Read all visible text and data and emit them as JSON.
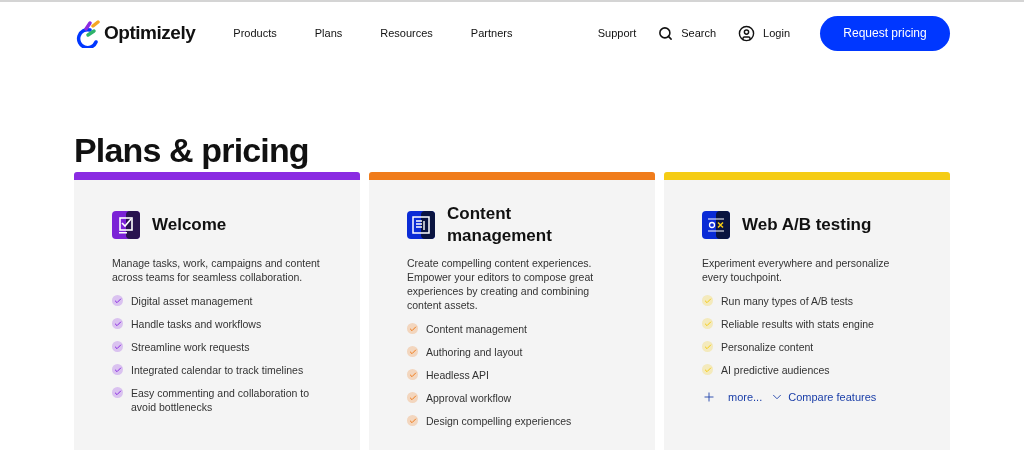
{
  "brand": {
    "name": "Optimizely"
  },
  "nav": [
    "Products",
    "Plans",
    "Resources",
    "Partners"
  ],
  "utility": [
    {
      "kind": "text",
      "label": "Support"
    },
    {
      "kind": "search",
      "label": "Search"
    },
    {
      "kind": "user",
      "label": "Login"
    }
  ],
  "cta": "Request pricing",
  "title": "Plans & pricing",
  "plans": [
    {
      "name": "Welcome",
      "kind": "board",
      "color": "#8a2be2",
      "description": "Manage tasks, work, campaigns and content across teams for seamless collaboration.",
      "features": [
        "Digital asset management",
        "Handle tasks and workflows",
        "Streamline work requests",
        "Integrated calendar to track timelines",
        "Easy commenting and collaboration to avoid bottlenecks"
      ]
    },
    {
      "name": "Content management",
      "kind": "document",
      "color": "#f07c1b",
      "description": "Create compelling content experiences. Empower your editors to compose great experiences by creating and combining content assets.",
      "features": [
        "Content management",
        "Authoring and layout",
        "Headless API",
        "Approval workflow",
        "Design compelling experiences"
      ]
    },
    {
      "name": "Web A/B testing",
      "kind": "ab",
      "color": "#f5cc14",
      "description": "Experiment everywhere and personalize every touchpoint.",
      "features": [
        "Run many types of A/B tests",
        "Reliable results with stats engine",
        "Personalize content",
        "AI predictive audiences"
      ],
      "more": "more...",
      "compare": "Compare features"
    }
  ]
}
